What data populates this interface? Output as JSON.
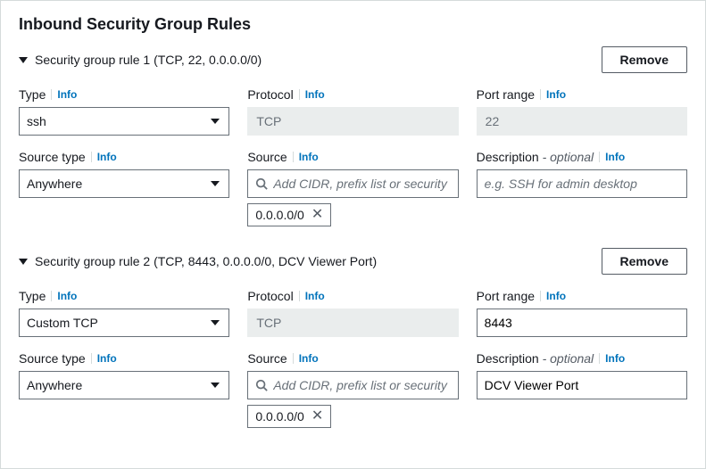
{
  "panel_title": "Inbound Security Group Rules",
  "labels": {
    "type": "Type",
    "protocol": "Protocol",
    "port_range": "Port range",
    "source_type": "Source type",
    "source": "Source",
    "description": "Description",
    "optional": " - optional",
    "info": "Info",
    "remove": "Remove"
  },
  "source_placeholder": "Add CIDR, prefix list or security",
  "rules": [
    {
      "title": "Security group rule 1 (TCP, 22, 0.0.0.0/0)",
      "type": "ssh",
      "protocol": "TCP",
      "port_range": "22",
      "port_range_readonly": true,
      "source_type": "Anywhere",
      "source_chip": "0.0.0.0/0",
      "description_placeholder": "e.g. SSH for admin desktop",
      "description": ""
    },
    {
      "title": "Security group rule 2 (TCP, 8443, 0.0.0.0/0, DCV Viewer Port)",
      "type": "Custom TCP",
      "protocol": "TCP",
      "port_range": "8443",
      "port_range_readonly": false,
      "source_type": "Anywhere",
      "source_chip": "0.0.0.0/0",
      "description_placeholder": "",
      "description": "DCV Viewer Port"
    }
  ]
}
